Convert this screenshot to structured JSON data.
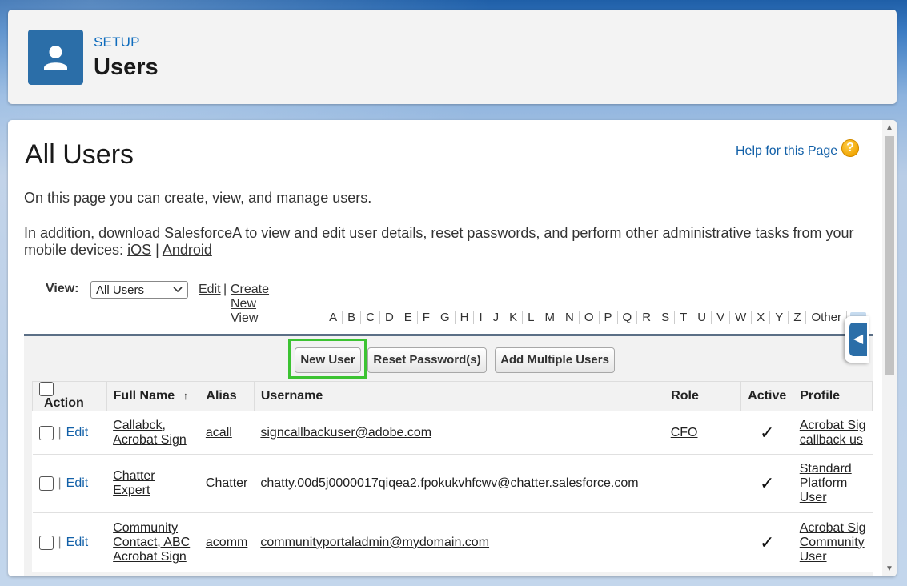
{
  "header": {
    "setup_label": "SETUP",
    "title": "Users"
  },
  "page": {
    "title": "All Users",
    "help_link": "Help for this Page",
    "help_icon": "?",
    "intro": "On this page you can create, view, and manage users.",
    "mobile_text": "In addition, download SalesforceA to view and edit user details, reset passwords, and perform other administrative tasks from your mobile devices:",
    "ios_link": "iOS",
    "separator": "|",
    "android_link": "Android"
  },
  "view": {
    "label": "View:",
    "selected": "All Users",
    "edit_link": "Edit",
    "separator": "|",
    "create_link": "Create New View"
  },
  "alphabet": [
    "A",
    "B",
    "C",
    "D",
    "E",
    "F",
    "G",
    "H",
    "I",
    "J",
    "K",
    "L",
    "M",
    "N",
    "O",
    "P",
    "Q",
    "R",
    "S",
    "T",
    "U",
    "V",
    "W",
    "X",
    "Y",
    "Z",
    "Other"
  ],
  "buttons": {
    "new_user": "New User",
    "reset_password": "Reset Password(s)",
    "add_multiple": "Add Multiple Users"
  },
  "table": {
    "headers": {
      "action": "Action",
      "full_name": "Full Name",
      "sort_indicator": "↑",
      "alias": "Alias",
      "username": "Username",
      "role": "Role",
      "active": "Active",
      "profile": "Profile"
    },
    "rows": [
      {
        "edit": "Edit",
        "full_name_1": "Callabck,",
        "full_name_2": "Acrobat Sign",
        "alias": "acall",
        "username": "signcallbackuser@adobe.com",
        "role": "CFO",
        "active": "✓",
        "profile_1": "Acrobat Sig",
        "profile_2": "callback us",
        "profile_3": ""
      },
      {
        "edit": "Edit",
        "full_name_1": "Chatter",
        "full_name_2": "Expert",
        "alias": "Chatter",
        "username": "chatty.00d5j0000017qiqea2.fpokukvhfcwv@chatter.salesforce.com",
        "role": "",
        "active": "✓",
        "profile_1": "Standard",
        "profile_2": "Platform",
        "profile_3": "User"
      },
      {
        "edit": "Edit",
        "full_name_1": "Community",
        "full_name_2": "Contact, ABC",
        "full_name_3": "Acrobat Sign",
        "alias": "acomm",
        "username": "communityportaladmin@mydomain.com",
        "role": "",
        "active": "✓",
        "profile_1": "Acrobat Sig",
        "profile_2": "Community",
        "profile_3": "User"
      }
    ]
  },
  "colors": {
    "accent": "#2b6ea8",
    "link": "#1260a8",
    "highlight": "#3cc332",
    "frame_border": "#5b6f86"
  }
}
